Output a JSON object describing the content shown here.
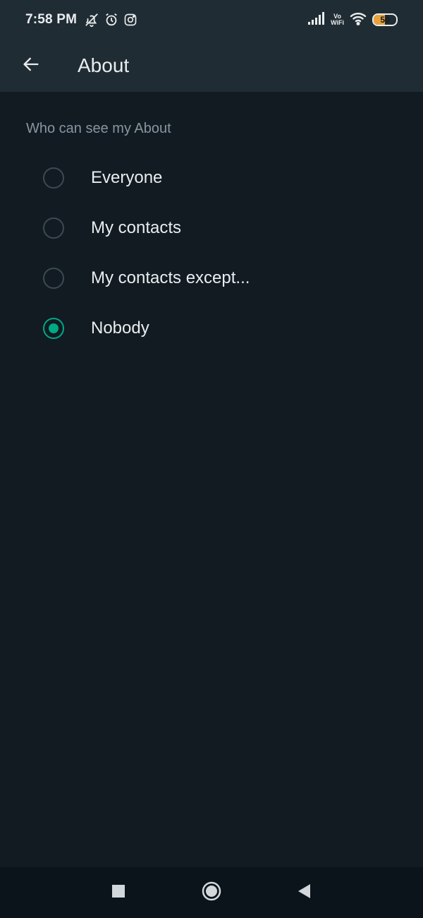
{
  "status_bar": {
    "time": "7:58 PM",
    "left_icons": [
      "mute-bell-icon",
      "alarm-icon",
      "instagram-icon"
    ],
    "vowifi_top": "Vo",
    "vowifi_bottom": "WiFi",
    "battery_level": "50",
    "battery_fraction": 0.5,
    "battery_color": "#e9a23b"
  },
  "app_bar": {
    "title": "About",
    "back_icon": "arrow-left-icon"
  },
  "section": {
    "header": "Who can see my About"
  },
  "options": [
    {
      "label": "Everyone",
      "checked": false
    },
    {
      "label": "My contacts",
      "checked": false
    },
    {
      "label": "My contacts except...",
      "checked": false
    },
    {
      "label": "Nobody",
      "checked": true
    }
  ],
  "colors": {
    "accent": "#00a884",
    "background": "#121b22",
    "bar": "#202c33",
    "secondary_text": "#8696a0"
  },
  "nav_bar": {
    "icons": [
      "square-recents-icon",
      "circle-home-icon",
      "triangle-back-icon"
    ]
  }
}
